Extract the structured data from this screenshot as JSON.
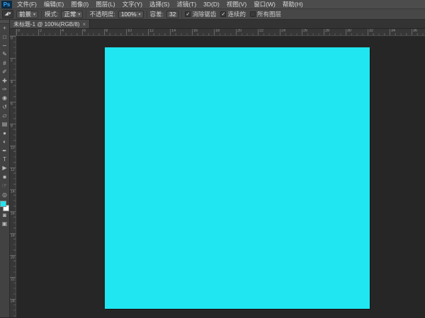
{
  "app": {
    "logo": "Ps",
    "logo_color": "#31a8ff"
  },
  "menu_bar": {
    "items": [
      "文件(F)",
      "编辑(E)",
      "图像(I)",
      "图层(L)",
      "文字(Y)",
      "选择(S)",
      "滤镜(T)",
      "3D(D)",
      "视图(V)",
      "窗口(W)",
      "帮助(H)"
    ]
  },
  "options_bar": {
    "tool_icon": "paint-bucket-tool",
    "tool_glyph": "◢",
    "tool_arrow": "▾",
    "fill_source_value": "前景",
    "mode_label": "模式:",
    "mode_value": "正常",
    "opacity_label": "不透明度:",
    "opacity_value": "100%",
    "tolerance_label": "容差:",
    "tolerance_value": "32",
    "checkboxes": [
      {
        "label": "消除锯齿",
        "checked": true
      },
      {
        "label": "连续的",
        "checked": true
      },
      {
        "label": "所有图层",
        "checked": false
      }
    ],
    "check_glyph": "✓"
  },
  "document_tab": {
    "title": "未标题-1 @ 100%(RGB/8)",
    "close_glyph": "×"
  },
  "toolbar": {
    "tools": [
      {
        "name": "move-tool",
        "glyph": "+"
      },
      {
        "name": "rectangular-marquee-tool",
        "glyph": "□"
      },
      {
        "name": "lasso-tool",
        "glyph": "∽"
      },
      {
        "name": "quick-selection-tool",
        "glyph": "✎"
      },
      {
        "name": "crop-tool",
        "glyph": "#"
      },
      {
        "name": "eyedropper-tool",
        "glyph": "✐"
      },
      {
        "name": "spot-healing-brush-tool",
        "glyph": "✚"
      },
      {
        "name": "brush-tool",
        "glyph": "✑"
      },
      {
        "name": "clone-stamp-tool",
        "glyph": "◉"
      },
      {
        "name": "history-brush-tool",
        "glyph": "↺"
      },
      {
        "name": "eraser-tool",
        "glyph": "▱"
      },
      {
        "name": "gradient-tool",
        "glyph": "▤"
      },
      {
        "name": "blur-tool",
        "glyph": "●"
      },
      {
        "name": "dodge-tool",
        "glyph": "◐"
      },
      {
        "name": "pen-tool",
        "glyph": "✒"
      },
      {
        "name": "type-tool",
        "glyph": "T"
      },
      {
        "name": "path-selection-tool",
        "glyph": "▶"
      },
      {
        "name": "rectangle-tool",
        "glyph": "■"
      },
      {
        "name": "hand-tool",
        "glyph": "☞"
      },
      {
        "name": "zoom-tool",
        "glyph": "◎"
      }
    ],
    "foreground_color": "#1fe6f0",
    "background_color": "#ffffff",
    "quick_mask_glyph": "◙",
    "screen_mode_glyph": "▣"
  },
  "rulers": {
    "horizontal_labels": [
      "0",
      "2",
      "4",
      "6",
      "8",
      "10",
      "12",
      "14",
      "16",
      "18",
      "20",
      "22",
      "24",
      "26",
      "28",
      "30",
      "32",
      "34",
      "36"
    ],
    "vertical_labels": [
      "0",
      "2",
      "4",
      "6",
      "8",
      "10",
      "12",
      "14",
      "16",
      "18",
      "20",
      "22",
      "24"
    ]
  },
  "canvas": {
    "fill_color": "#1fe6f0"
  },
  "colors": {
    "accent_blue": "#31a8ff",
    "ui_dark": "#474747",
    "pasteboard": "#262626"
  }
}
